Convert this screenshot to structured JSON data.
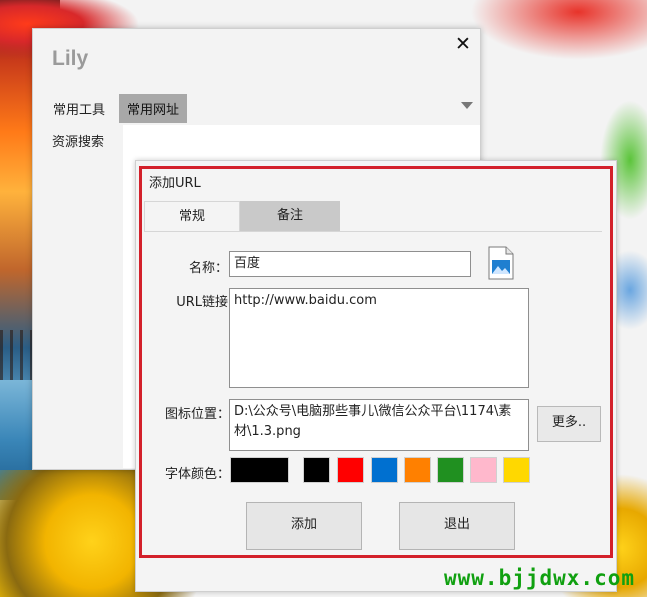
{
  "lily": {
    "title": "Lily",
    "close_glyph": "✕",
    "menu": [
      "常用工具",
      "常用网址"
    ],
    "sidebar": [
      "资源搜索"
    ]
  },
  "dialog": {
    "title": "添加URL",
    "tabs": [
      "常规",
      "备注"
    ],
    "name_label": "名称：",
    "name_value": "百度",
    "url_label": "URL链接",
    "url_value": "http://www.baidu.com",
    "icon_label": "图标位置：",
    "icon_value": "D:\\公众号\\电脑那些事儿\\微信公众平台\\1174\\素材\\1.3.png",
    "more_label": "更多..",
    "color_label": "字体颜色：",
    "colors": {
      "selected": "#000000",
      "swatches": [
        "#000000",
        "#ff0000",
        "#0070d0",
        "#ff8000",
        "#209020",
        "#ffb8cc",
        "#ffd800"
      ]
    },
    "add_label": "添加",
    "exit_label": "退出"
  },
  "watermark": "www.bjjdwx.com",
  "accent": "#d3202a"
}
